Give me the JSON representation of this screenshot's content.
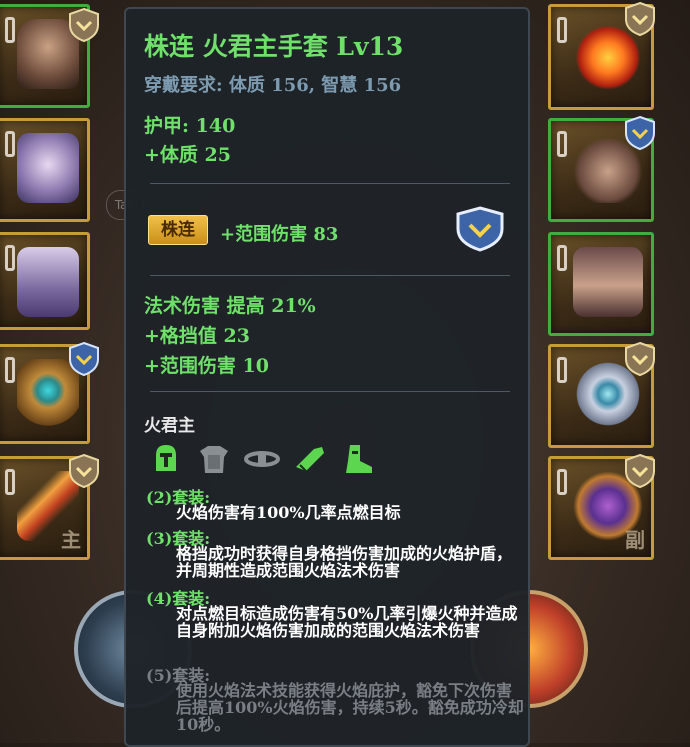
{
  "tooltip": {
    "title": "株连  火君主手套  Lv13",
    "requirement": "穿戴要求:   体质  156, 智慧  156",
    "armor": "护甲:  140",
    "constitution": "+体质  25",
    "gem_label": "株连",
    "gem_stat": "+范围伤害  83",
    "stat1": "法术伤害  提高  21%",
    "stat2": "+格挡值  23",
    "stat3": "+范围伤害  10",
    "set_name": "火君主",
    "set_bonuses": [
      {
        "header": "(2)套装:",
        "text": "火焰伤害有100%几率点燃目标",
        "active": true
      },
      {
        "header": "(3)套装:",
        "text": "格挡成功时获得自身格挡伤害加成的火焰护盾，并周期性造成范围火焰法术伤害",
        "active": true
      },
      {
        "header": "(4)套装:",
        "text": "对点燃目标造成伤害有50%几率引爆火种并造成自身附加火焰伤害加成的范围火焰法术伤害",
        "active": true
      },
      {
        "header": "(5)套装:",
        "text": "使用火焰法术技能获得火焰庇护，豁免下次伤害后提高100%火焰伤害，持续5秒。豁免成功冷却10秒。",
        "active": false
      }
    ]
  },
  "slots": {
    "left_tag": "主",
    "right_tag": "副"
  },
  "hints": {
    "tab": "Tab"
  },
  "colors": {
    "green": "#6fe06a",
    "gold": "#c79b3a",
    "inactive": "#7a7f85"
  }
}
